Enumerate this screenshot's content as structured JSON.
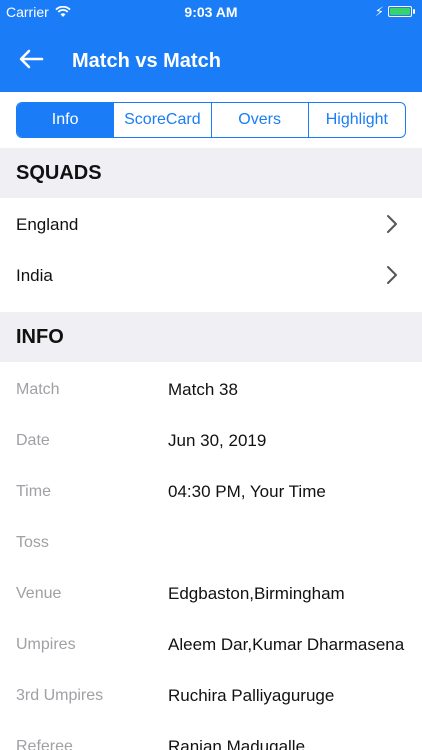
{
  "status": {
    "carrier": "Carrier",
    "time": "9:03 AM"
  },
  "nav": {
    "title": "Match vs Match"
  },
  "tabs": [
    {
      "label": "Info",
      "active": true
    },
    {
      "label": "ScoreCard",
      "active": false
    },
    {
      "label": "Overs",
      "active": false
    },
    {
      "label": "Highlight",
      "active": false
    }
  ],
  "squads": {
    "title": "SQUADS",
    "teams": [
      "England",
      "India"
    ]
  },
  "info": {
    "title": "INFO",
    "rows": [
      {
        "key": "Match",
        "value": "Match 38"
      },
      {
        "key": "Date",
        "value": "Jun 30, 2019"
      },
      {
        "key": "Time",
        "value": "04:30 PM, Your Time"
      },
      {
        "key": "Toss",
        "value": ""
      },
      {
        "key": "Venue",
        "value": "Edgbaston,Birmingham"
      },
      {
        "key": "Umpires",
        "value": "Aleem Dar,Kumar Dharmasena"
      },
      {
        "key": "3rd Umpires",
        "value": "Ruchira Palliyaguruge"
      },
      {
        "key": "Referee",
        "value": "Ranjan Madugalle"
      }
    ]
  },
  "colors": {
    "accent": "#1a7df7",
    "section_bg": "#efeff4",
    "battery": "#38d36b"
  }
}
